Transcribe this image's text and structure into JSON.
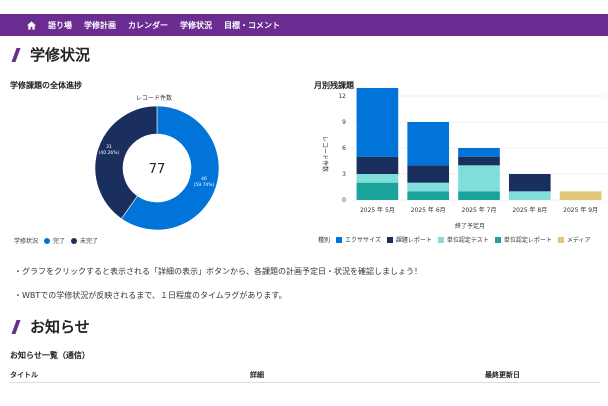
{
  "nav": {
    "items": [
      "語り場",
      "学修計画",
      "カレンダー",
      "学修状況",
      "目標・コメント"
    ],
    "accent": "#6a2c91"
  },
  "section1": {
    "title": "学修状況"
  },
  "donut": {
    "subtitle": "学修課題の全体進捗",
    "chart_title": "レコード件数",
    "center": "77",
    "legend_title": "学修状況",
    "legend": [
      "完了",
      "未完了"
    ],
    "slice_labels": [
      {
        "count": "46",
        "pct": "(59.74%)"
      },
      {
        "count": "31",
        "pct": "(40.26%)"
      }
    ]
  },
  "bar": {
    "subtitle": "月別残課題",
    "ylabel": "レコード件数",
    "xlabel": "終了予定月",
    "legend_title": "種別"
  },
  "chart_data": [
    {
      "type": "pie",
      "title": "レコード件数",
      "categories": [
        "完了",
        "未完了"
      ],
      "values": [
        46,
        31
      ],
      "colors": [
        "#0074d9",
        "#1b2f5e"
      ],
      "total": 77
    },
    {
      "type": "bar",
      "stacked": true,
      "title": "",
      "xlabel": "終了予定月",
      "ylabel": "レコード件数",
      "categories": [
        "2025 年 5月",
        "2025 年 6月",
        "2025 年 7月",
        "2025 年 8月",
        "2025 年 9月"
      ],
      "ylim": [
        0,
        12
      ],
      "yticks": [
        0,
        3,
        6,
        9,
        12
      ],
      "series": [
        {
          "name": "単位認定レポート",
          "color": "#1aa39b",
          "values": [
            2,
            1,
            1,
            0,
            0
          ]
        },
        {
          "name": "単位認定テスト",
          "color": "#7fded9",
          "values": [
            1,
            1,
            3,
            1,
            0
          ]
        },
        {
          "name": "課題レポート",
          "color": "#1b2f5e",
          "values": [
            2,
            2,
            1,
            2,
            0
          ]
        },
        {
          "name": "エクササイズ",
          "color": "#0074d9",
          "values": [
            9,
            5,
            1,
            0,
            0
          ]
        },
        {
          "name": "メディア",
          "color": "#e2c77a",
          "values": [
            0,
            0,
            0,
            0,
            1
          ]
        }
      ],
      "legend_order": [
        "エクササイズ",
        "課題レポート",
        "単位認定テスト",
        "単位認定レポート",
        "メディア"
      ]
    }
  ],
  "notes": [
    "・グラフをクリックすると表示される「詳細の表示」ボタンから、各課題の計画予定日・状況を確認しましょう！",
    "・WBTでの学修状況が反映されるまで、１日程度のタイムラグがあります。"
  ],
  "section2": {
    "title": "お知らせ"
  },
  "news": {
    "subtitle": "お知らせ一覧（通信）",
    "columns": [
      "タイトル",
      "詳細",
      "最終更新日"
    ]
  }
}
